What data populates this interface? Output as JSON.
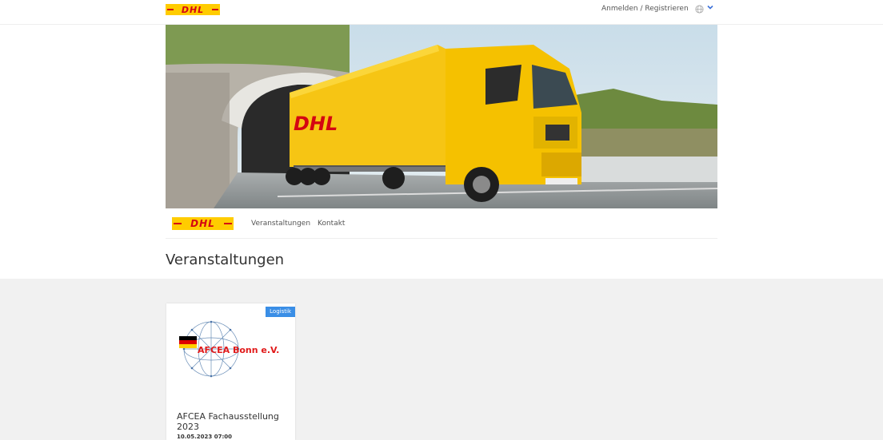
{
  "header": {
    "logo_text": "DHL",
    "login_label": "Anmelden / Registrieren",
    "language_icon": "globe-icon",
    "language_chevron": "chevron-down-icon"
  },
  "hero": {
    "truck_logo_text": "DHL"
  },
  "nav": {
    "logo_text": "DHL",
    "items": [
      "Veranstaltungen",
      "Kontakt"
    ]
  },
  "page": {
    "title": "Veranstaltungen"
  },
  "events": [
    {
      "badge": "Logistik",
      "logo_text": "AFCEA Bonn e.V.",
      "title": "AFCEA Fachausstellung 2023",
      "date": "10.05.2023 07:00"
    }
  ],
  "colors": {
    "dhl_yellow": "#FFCC00",
    "dhl_red": "#D40511",
    "badge_blue": "#3a8ee6",
    "accent_blue": "#3a6fd8"
  }
}
